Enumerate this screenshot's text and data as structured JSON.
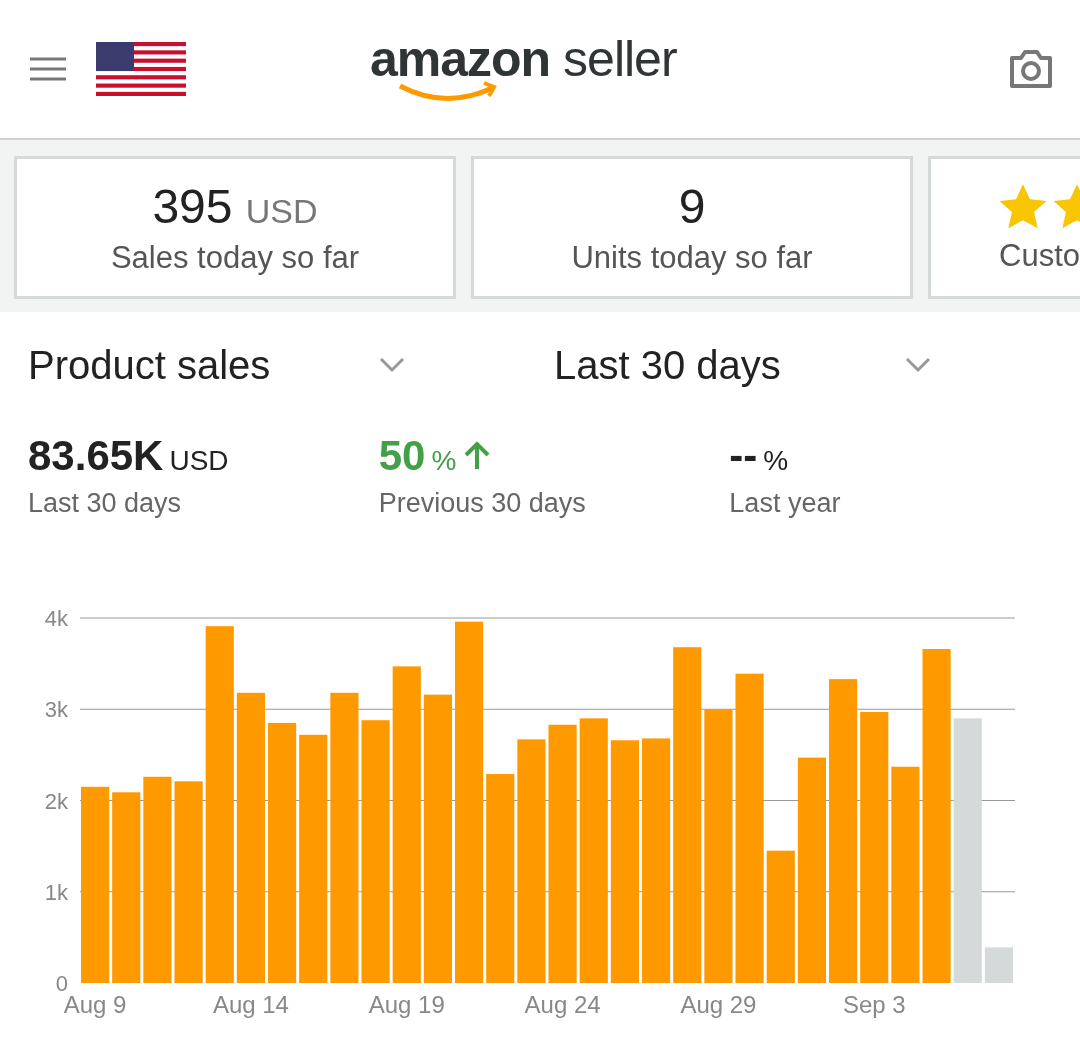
{
  "header": {
    "logo": {
      "brand": "amazon",
      "product": "seller"
    }
  },
  "summary_cards": [
    {
      "kind": "value",
      "value": "395",
      "unit": "USD",
      "label": "Sales today so far"
    },
    {
      "kind": "value",
      "value": "9",
      "label": "Units today so far"
    },
    {
      "kind": "rating",
      "label": "Custo"
    }
  ],
  "selectors": [
    {
      "label": "Product sales"
    },
    {
      "label": "Last 30 days"
    }
  ],
  "metrics": [
    {
      "kind": "total",
      "value": "83.65K",
      "unit": "USD",
      "label": "Last 30 days"
    },
    {
      "kind": "increase",
      "value": "50",
      "unit": "%",
      "label": "Previous 30 days"
    },
    {
      "kind": "neutral",
      "value": "--",
      "unit": "%",
      "label": "Last year"
    }
  ],
  "chart": {
    "x_axis_labels": [
      "Aug 9",
      "Aug 14",
      "Aug 19",
      "Aug 24",
      "Aug 29",
      "Sep 3"
    ],
    "chart_data": {
      "type": "bar",
      "grid": true,
      "series": [
        {
          "color": "#ff9900",
          "values": [
            2150,
            2090,
            2260,
            2210,
            3910,
            3180,
            2850,
            2720,
            3180,
            2880,
            3470,
            3160,
            3960,
            2290,
            2670,
            2830,
            2900,
            2660,
            2680,
            3680,
            3000,
            3390,
            1450,
            2470,
            3330,
            2970,
            2370,
            3660,
            null,
            null
          ]
        },
        {
          "color": "#d5d9d9",
          "values": [
            null,
            null,
            null,
            null,
            null,
            null,
            null,
            null,
            null,
            null,
            null,
            null,
            null,
            null,
            null,
            null,
            null,
            null,
            null,
            null,
            null,
            null,
            null,
            null,
            null,
            null,
            null,
            null,
            2900,
            390
          ]
        }
      ],
      "ylim": [
        0,
        4000
      ],
      "yticks": [
        {
          "value": 0,
          "label": "0"
        },
        {
          "value": 1000,
          "label": "1k"
        },
        {
          "value": 2000,
          "label": "2k"
        },
        {
          "value": 3000,
          "label": "3k"
        },
        {
          "value": 4000,
          "label": "4k"
        }
      ]
    }
  }
}
